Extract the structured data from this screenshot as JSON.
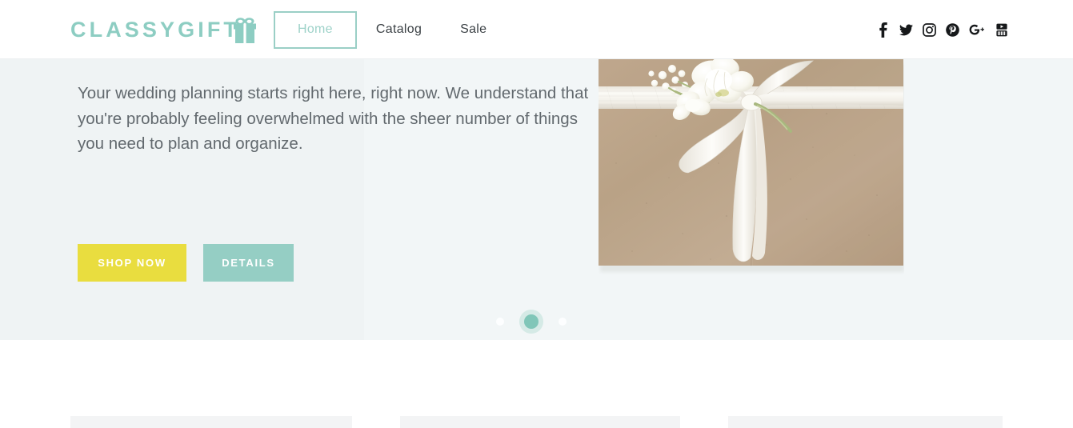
{
  "header": {
    "logo": {
      "text": "CLASSYGIFT",
      "icon": "gift-box-icon",
      "color": "#8dcdc2"
    },
    "nav": [
      {
        "label": "Home",
        "active": true
      },
      {
        "label": "Catalog",
        "active": false
      },
      {
        "label": "Sale",
        "active": false
      }
    ],
    "social": [
      {
        "name": "facebook-icon",
        "label": "Facebook"
      },
      {
        "name": "twitter-icon",
        "label": "Twitter"
      },
      {
        "name": "instagram-icon",
        "label": "Instagram"
      },
      {
        "name": "pinterest-icon",
        "label": "Pinterest"
      },
      {
        "name": "googleplus-icon",
        "label": "Google Plus"
      },
      {
        "name": "youtube-icon",
        "label": "YouTube"
      }
    ]
  },
  "hero": {
    "body_text": "Your wedding planning starts right here, right now. We understand that you're probably feeling overwhelmed with the sheer number of things you need to plan and organize.",
    "buttons": {
      "primary_label": "SHOP NOW",
      "primary_color": "#e9dd3f",
      "secondary_label": "DETAILS",
      "secondary_color": "#95cec4"
    },
    "carousel": {
      "slide_count": 3,
      "active_slide": 2,
      "active_color": "#80c6b8"
    },
    "image": {
      "name": "wrapped-gift-photo",
      "description": "Kraft paper wrapped gift with white ribbon bow and white flowers"
    },
    "background_color": "#eff4f5"
  },
  "content_section": {
    "placeholder_cards": 3,
    "card_color": "#f3f4f5"
  }
}
